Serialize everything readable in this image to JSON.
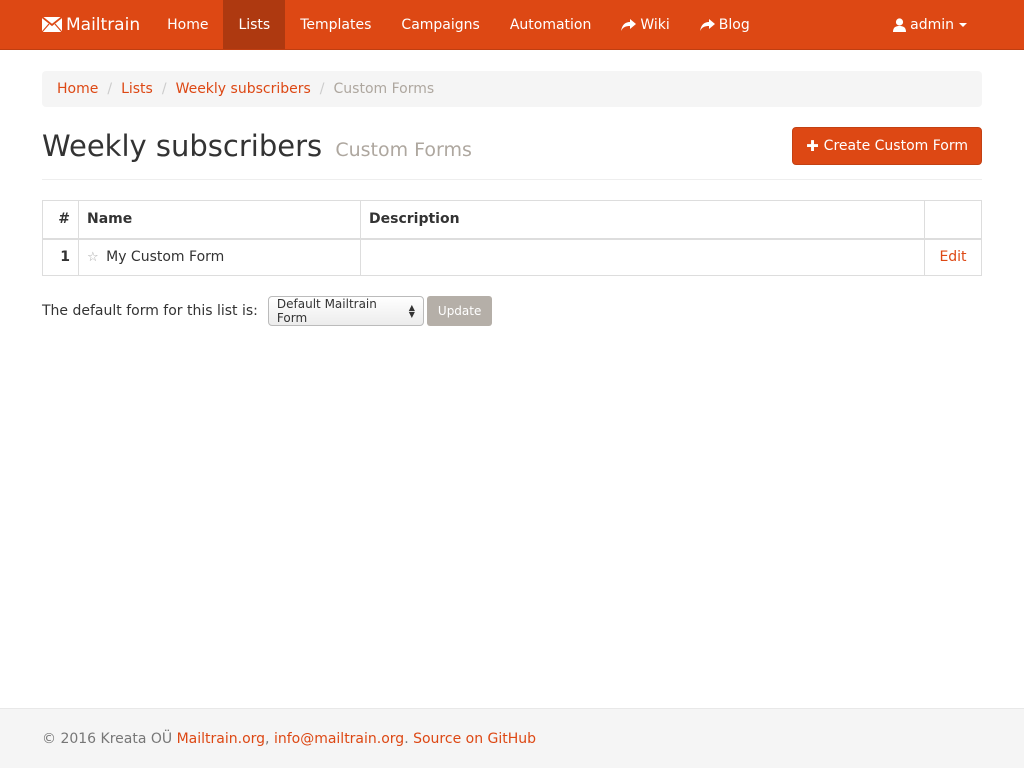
{
  "navbar": {
    "brand": "Mailtrain",
    "brand_icon": "envelope-icon",
    "items": [
      {
        "label": "Home"
      },
      {
        "label": "Lists",
        "active": true
      },
      {
        "label": "Templates"
      },
      {
        "label": "Campaigns"
      },
      {
        "label": "Automation"
      },
      {
        "label": "Wiki",
        "icon": "share-arrow-icon"
      },
      {
        "label": "Blog",
        "icon": "share-arrow-icon"
      }
    ],
    "user": {
      "label": "admin",
      "icon": "user-icon"
    }
  },
  "breadcrumb": {
    "items": [
      "Home",
      "Lists",
      "Weekly subscribers"
    ],
    "current": "Custom Forms"
  },
  "page": {
    "title": "Weekly subscribers",
    "subtitle": "Custom Forms",
    "create_button": "Create Custom Form"
  },
  "table": {
    "headers": [
      "#",
      "Name",
      "Description",
      ""
    ],
    "rows": [
      {
        "num": "1",
        "name": "My Custom Form",
        "description": "",
        "action": "Edit"
      }
    ]
  },
  "default_form": {
    "label": "The default form for this list is:",
    "selected": "Default Mailtrain Form",
    "update_button": "Update"
  },
  "footer": {
    "copyright": "© 2016 Kreata OÜ",
    "link1": "Mailtrain.org",
    "sep": ",",
    "link2": "info@mailtrain.org",
    "dot": ".",
    "link3": "Source on GitHub"
  },
  "colors": {
    "brand": "#dd4814",
    "active_nav": "#ae3910",
    "muted": "#aea79f"
  }
}
